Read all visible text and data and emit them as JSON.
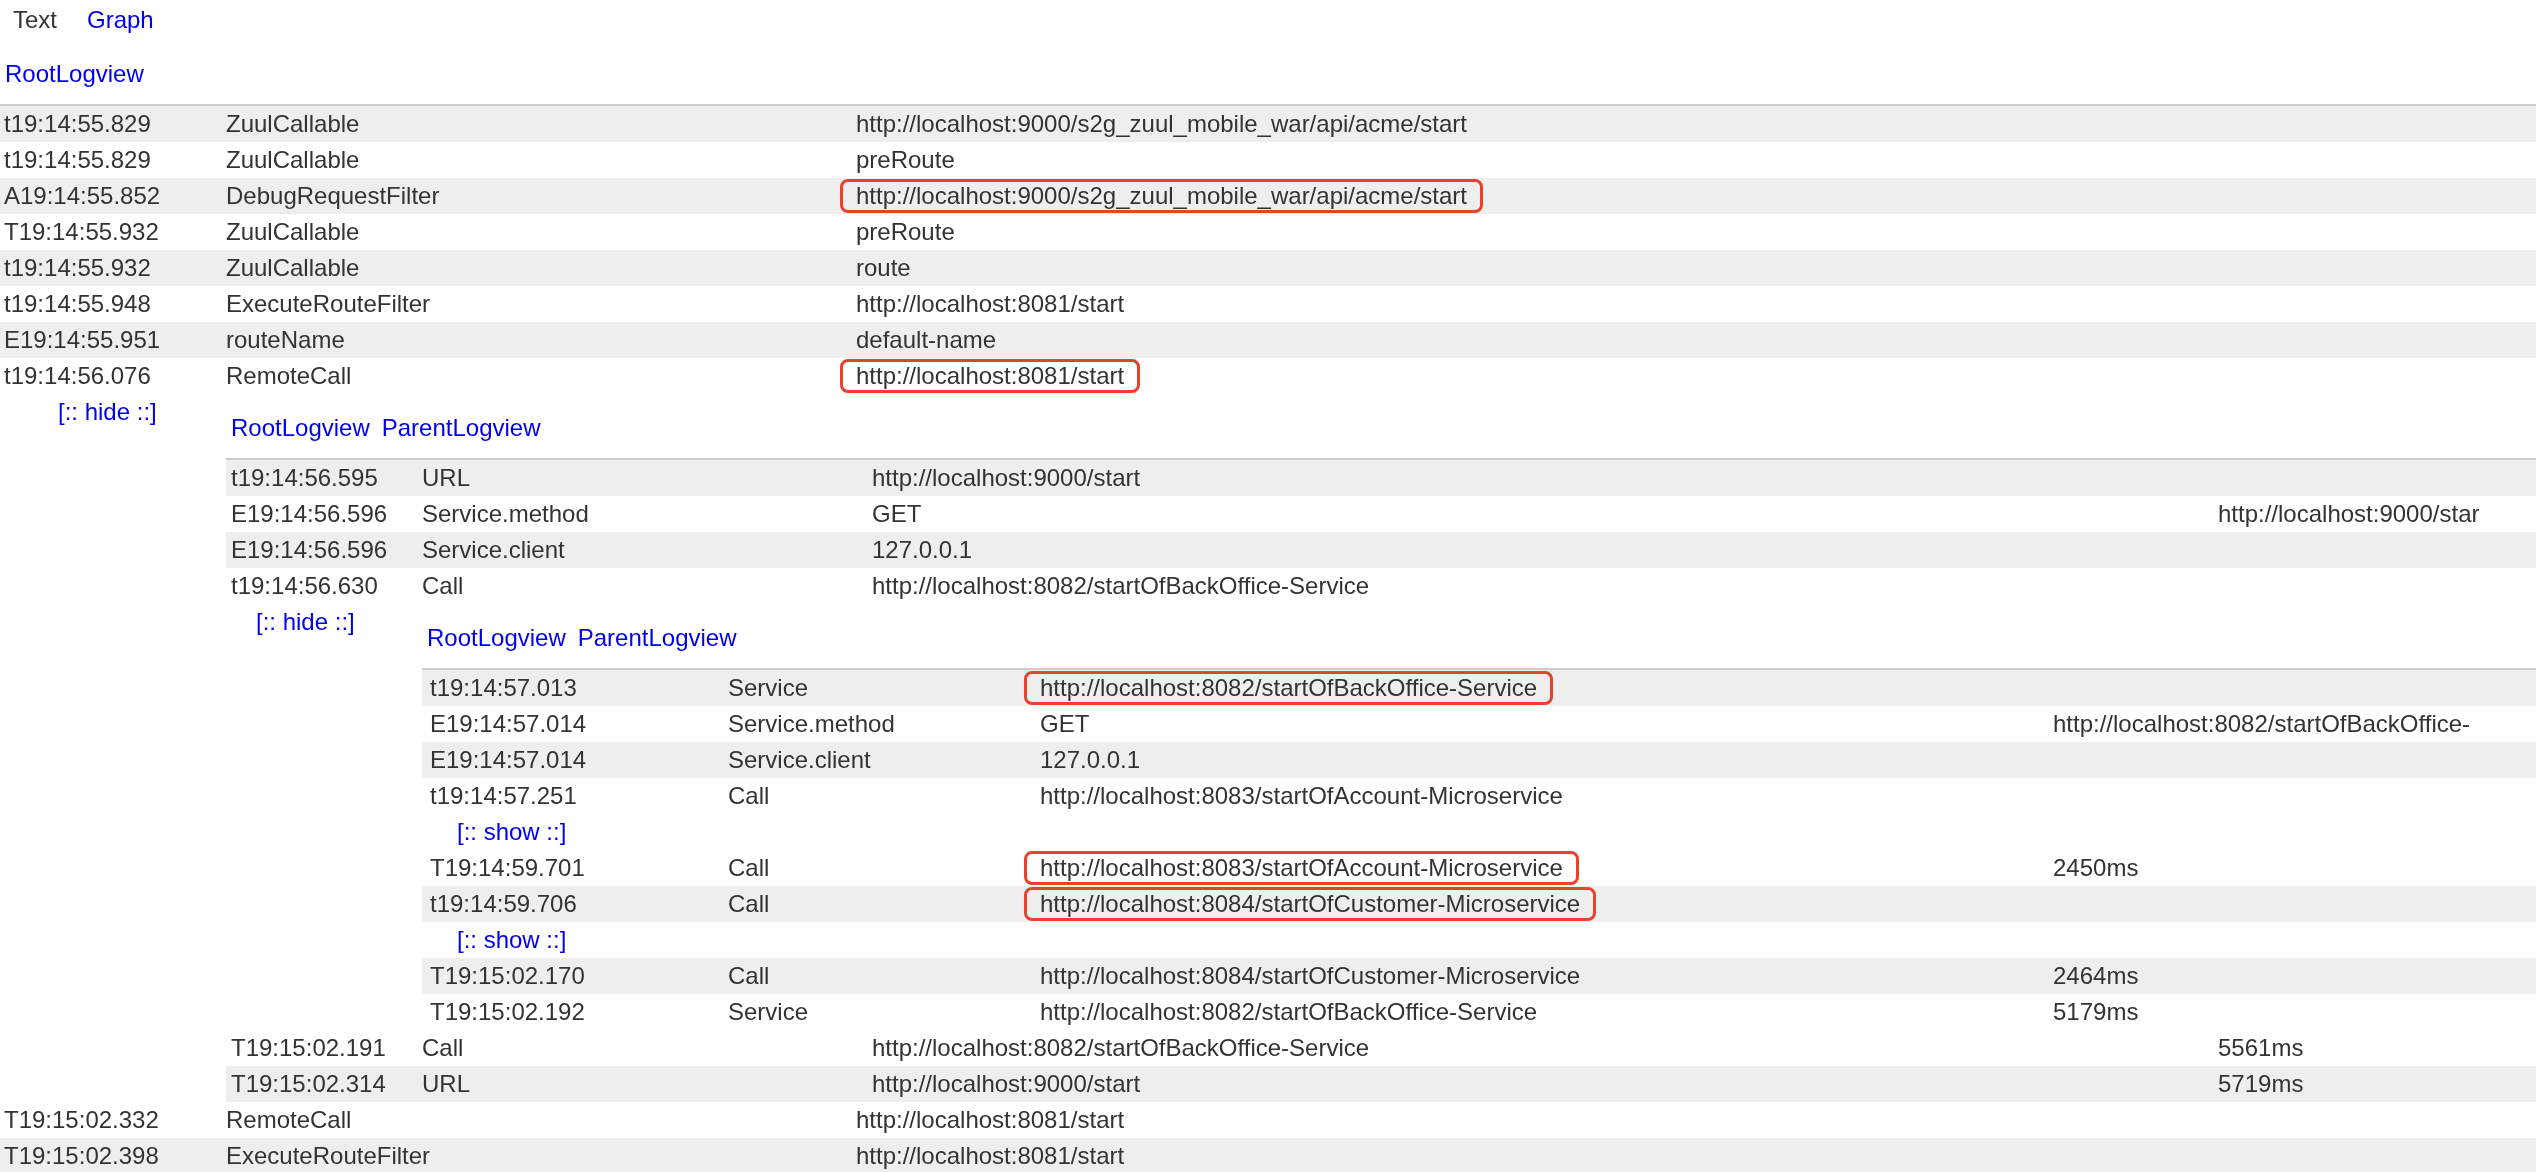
{
  "view_tabs": [
    {
      "label": "Text",
      "selected": true
    },
    {
      "label": "Graph",
      "selected": false
    }
  ],
  "logview": {
    "links": [
      "RootLogview"
    ],
    "entries": [
      {
        "time": "t19:14:55.829",
        "name": "ZuulCallable",
        "value": "http://localhost:9000/s2g_zuul_mobile_war/api/acme/start",
        "annotated": false
      },
      {
        "time": "t19:14:55.829",
        "name": "ZuulCallable",
        "value": "preRoute",
        "annotated": false
      },
      {
        "time": "A19:14:55.852",
        "name": "DebugRequestFilter",
        "value": "http://localhost:9000/s2g_zuul_mobile_war/api/acme/start",
        "annotated": true
      },
      {
        "time": "T19:14:55.932",
        "name": "ZuulCallable",
        "value": "preRoute",
        "annotated": false
      },
      {
        "time": "t19:14:55.932",
        "name": "ZuulCallable",
        "value": "route",
        "annotated": false
      },
      {
        "time": "t19:14:55.948",
        "name": "ExecuteRouteFilter",
        "value": "http://localhost:8081/start",
        "annotated": false
      },
      {
        "time": "E19:14:55.951",
        "name": "routeName",
        "value": "default-name",
        "annotated": false
      },
      {
        "time": "t19:14:56.076",
        "name": "RemoteCall",
        "value": "http://localhost:8081/start",
        "annotated": true,
        "expander": {
          "label": "[:: hide ::]",
          "logview": {
            "links": [
              "RootLogview",
              "ParentLogview"
            ],
            "entries": [
              {
                "time": "t19:14:56.595",
                "name": "URL",
                "value": "http://localhost:9000/start",
                "annotated": false
              },
              {
                "time": "E19:14:56.596",
                "name": "Service.method",
                "value": "GET",
                "extra": "http://localhost:9000/star",
                "annotated": false
              },
              {
                "time": "E19:14:56.596",
                "name": "Service.client",
                "value": "127.0.0.1",
                "annotated": false
              },
              {
                "time": "t19:14:56.630",
                "name": "Call",
                "value": "http://localhost:8082/startOfBackOffice-Service",
                "annotated": false,
                "expander": {
                  "label": "[:: hide ::]",
                  "logview": {
                    "links": [
                      "RootLogview",
                      "ParentLogview"
                    ],
                    "entries": [
                      {
                        "time": "t19:14:57.013",
                        "name": "Service",
                        "value": "http://localhost:8082/startOfBackOffice-Service",
                        "annotated": true
                      },
                      {
                        "time": "E19:14:57.014",
                        "name": "Service.method",
                        "value": "GET",
                        "extra": "http://localhost:8082/startOfBackOffice-",
                        "annotated": false
                      },
                      {
                        "time": "E19:14:57.014",
                        "name": "Service.client",
                        "value": "127.0.0.1",
                        "annotated": false
                      },
                      {
                        "time": "t19:14:57.251",
                        "name": "Call",
                        "value": "http://localhost:8083/startOfAccount-Microservice",
                        "annotated": false,
                        "expander": {
                          "label": "[:: show ::]"
                        }
                      },
                      {
                        "time": "T19:14:59.701",
                        "name": "Call",
                        "value": "http://localhost:8083/startOfAccount-Microservice",
                        "extra": "2450ms",
                        "annotated": true
                      },
                      {
                        "time": "t19:14:59.706",
                        "name": "Call",
                        "value": "http://localhost:8084/startOfCustomer-Microservice",
                        "annotated": true,
                        "expander": {
                          "label": "[:: show ::]"
                        }
                      },
                      {
                        "time": "T19:15:02.170",
                        "name": "Call",
                        "value": "http://localhost:8084/startOfCustomer-Microservice",
                        "extra": "2464ms",
                        "annotated": false
                      },
                      {
                        "time": "T19:15:02.192",
                        "name": "Service",
                        "value": "http://localhost:8082/startOfBackOffice-Service",
                        "extra": "5179ms",
                        "annotated": false
                      }
                    ]
                  }
                }
              },
              {
                "time": "T19:15:02.191",
                "name": "Call",
                "value": "http://localhost:8082/startOfBackOffice-Service",
                "extra": "5561ms",
                "annotated": false
              },
              {
                "time": "T19:15:02.314",
                "name": "URL",
                "value": "http://localhost:9000/start",
                "extra": "5719ms",
                "annotated": false
              }
            ]
          }
        }
      },
      {
        "time": "T19:15:02.332",
        "name": "RemoteCall",
        "value": "http://localhost:8081/start",
        "annotated": false
      },
      {
        "time": "T19:15:02.398",
        "name": "ExecuteRouteFilter",
        "value": "http://localhost:8081/start",
        "annotated": false
      }
    ]
  }
}
